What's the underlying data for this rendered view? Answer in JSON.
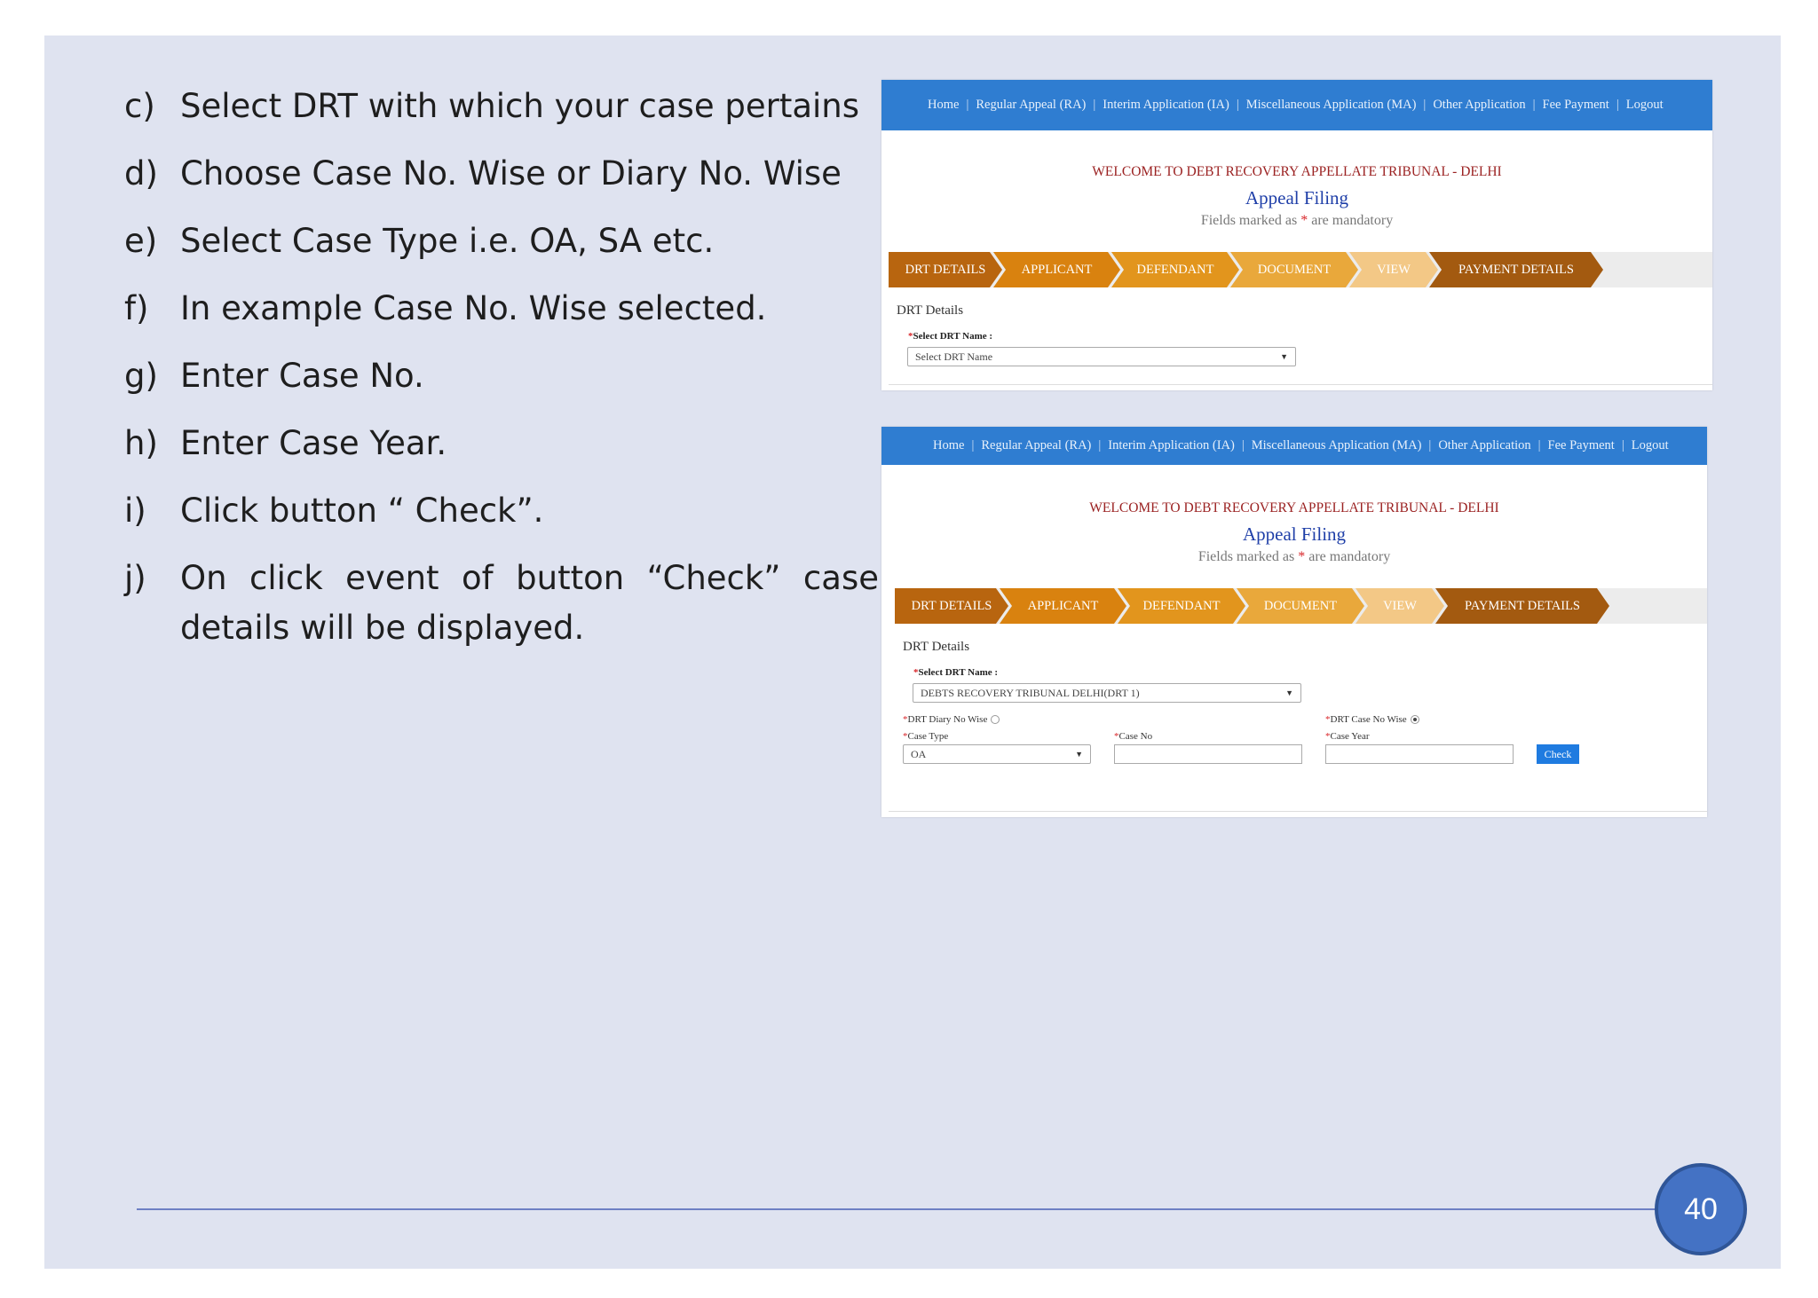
{
  "steps": [
    {
      "marker": "c)",
      "text": "Select DRT with which your case pertains"
    },
    {
      "marker": "d)",
      "text": "Choose Case No. Wise or Diary No. Wise"
    },
    {
      "marker": "e)",
      "text": "Select Case Type i.e. OA, SA etc."
    },
    {
      "marker": "f)",
      "text": "In example Case No. Wise selected."
    },
    {
      "marker": "g)",
      "text": "Enter Case No."
    },
    {
      "marker": "h)",
      "text": "Enter Case Year."
    },
    {
      "marker": "i)",
      "text": "Click button “ Check”."
    },
    {
      "marker": "j)",
      "text": "On click event of button “Check” case details will be displayed."
    }
  ],
  "portal": {
    "nav": [
      "Home",
      "Regular Appeal (RA)",
      "Interim Application (IA)",
      "Miscellaneous Application (MA)",
      "Other Application",
      "Fee Payment",
      "Logout"
    ],
    "separator": "|",
    "welcome": "WELCOME TO DEBT RECOVERY APPELLATE TRIBUNAL - DELHI",
    "page_title": "Appeal Filing",
    "mandatory_prefix": "Fields marked as",
    "mandatory_star": "*",
    "mandatory_suffix": "are mandatory",
    "wizard_steps": [
      {
        "label": "DRT DETAILS",
        "color": "#b8650f"
      },
      {
        "label": "APPLICANT",
        "color": "#d9820f"
      },
      {
        "label": "DEFENDANT",
        "color": "#e2951d"
      },
      {
        "label": "DOCUMENT",
        "color": "#e9a83b"
      },
      {
        "label": "VIEW",
        "color": "#f3c886"
      },
      {
        "label": "PAYMENT DETAILS",
        "color": "#a35a10"
      }
    ],
    "section_label": "DRT Details",
    "drt_name_label": "Select DRT Name :",
    "required_star": "*"
  },
  "screen1": {
    "drt_select_value": "Select DRT Name"
  },
  "screen2": {
    "drt_select_value": "DEBTS RECOVERY TRIBUNAL DELHI(DRT 1)",
    "diary_wise_label": "DRT Diary No Wise",
    "case_wise_label": "DRT Case No Wise",
    "case_type_label": "Case Type",
    "case_type_value": "OA",
    "case_no_label": "Case No",
    "case_no_value": "",
    "case_year_label": "Case Year",
    "case_year_value": "",
    "check_button": "Check"
  },
  "page_number": "40",
  "colors": {
    "slide_background": "#dfe3f0",
    "nav_blue": "#2f7dd1",
    "welcome_red": "#9b2222",
    "title_blue": "#1f3fa8",
    "button_blue": "#1f7be0",
    "page_circle": "#4472c4"
  }
}
